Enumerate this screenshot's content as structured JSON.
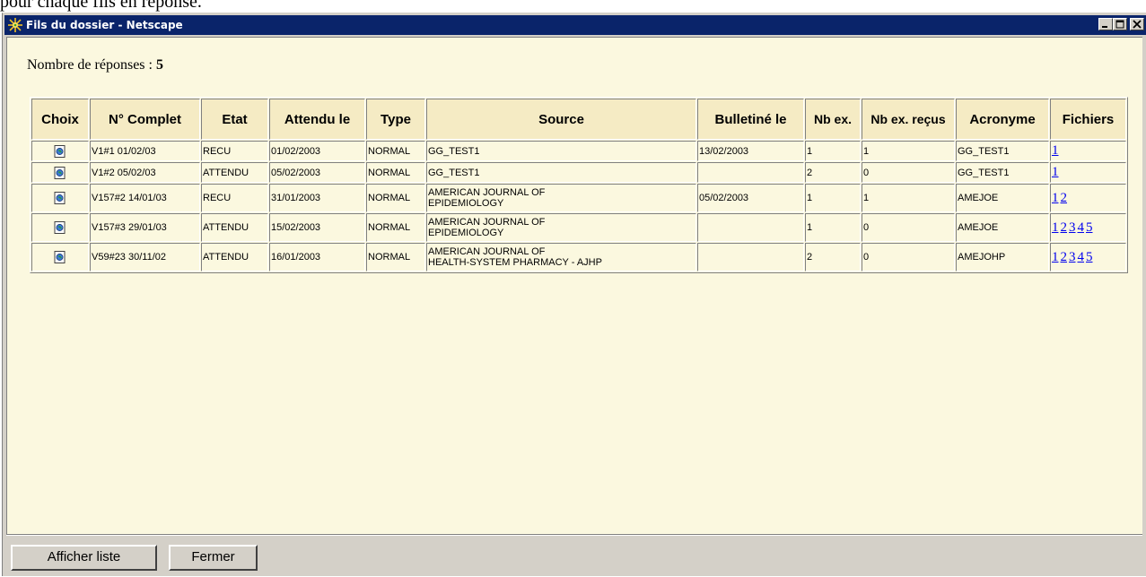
{
  "background_text": "pour chaque fils en réponse.",
  "window": {
    "title": "Fils du dossier - Netscape",
    "controls": {
      "minimize": "_",
      "maximize": "□",
      "close": "x"
    }
  },
  "results": {
    "label": "Nombre de réponses : ",
    "count": "5"
  },
  "table": {
    "columns": [
      "Choix",
      "N° Complet",
      "Etat",
      "Attendu le",
      "Type",
      "Source",
      "Bulletiné le",
      "Nb ex.",
      "Nb ex. reçus",
      "Acronyme",
      "Fichiers"
    ],
    "rows": [
      {
        "numero": "V1#1 01/02/03",
        "etat": "RECU",
        "attendu": "01/02/2003",
        "type": "NORMAL",
        "source": [
          "GG_TEST1"
        ],
        "bulletine": "13/02/2003",
        "nb_ex": "1",
        "nb_recus": "1",
        "acronyme": "GG_TEST1",
        "fichiers": [
          "1"
        ]
      },
      {
        "numero": "V1#2 05/02/03",
        "etat": "ATTENDU",
        "attendu": "05/02/2003",
        "type": "NORMAL",
        "source": [
          "GG_TEST1"
        ],
        "bulletine": "",
        "nb_ex": "2",
        "nb_recus": "0",
        "acronyme": "GG_TEST1",
        "fichiers": [
          "1"
        ]
      },
      {
        "numero": "V157#2 14/01/03",
        "etat": "RECU",
        "attendu": "31/01/2003",
        "type": "NORMAL",
        "source": [
          "AMERICAN JOURNAL OF",
          "EPIDEMIOLOGY"
        ],
        "bulletine": "05/02/2003",
        "nb_ex": "1",
        "nb_recus": "1",
        "acronyme": "AMEJOE",
        "fichiers": [
          "1",
          "2"
        ]
      },
      {
        "numero": "V157#3 29/01/03",
        "etat": "ATTENDU",
        "attendu": "15/02/2003",
        "type": "NORMAL",
        "source": [
          "AMERICAN JOURNAL OF",
          "EPIDEMIOLOGY"
        ],
        "bulletine": "",
        "nb_ex": "1",
        "nb_recus": "0",
        "acronyme": "AMEJOE",
        "fichiers": [
          "1",
          "2",
          "3",
          "4",
          "5"
        ]
      },
      {
        "numero": "V59#23 30/11/02",
        "etat": "ATTENDU",
        "attendu": "16/01/2003",
        "type": "NORMAL",
        "source": [
          "AMERICAN JOURNAL OF",
          "HEALTH-SYSTEM PHARMACY - AJHP"
        ],
        "bulletine": "",
        "nb_ex": "2",
        "nb_recus": "0",
        "acronyme": "AMEJOHP",
        "fichiers": [
          "1",
          "2",
          "3",
          "4",
          "5"
        ]
      }
    ]
  },
  "buttons": {
    "afficher_liste": "Afficher liste",
    "fermer": "Fermer"
  },
  "colors": {
    "titlebar": "#0a246a",
    "content_bg": "#fbf8df",
    "header_bg": "#f5ebc4",
    "chrome": "#d4d0c8",
    "link": "#0000ee"
  }
}
